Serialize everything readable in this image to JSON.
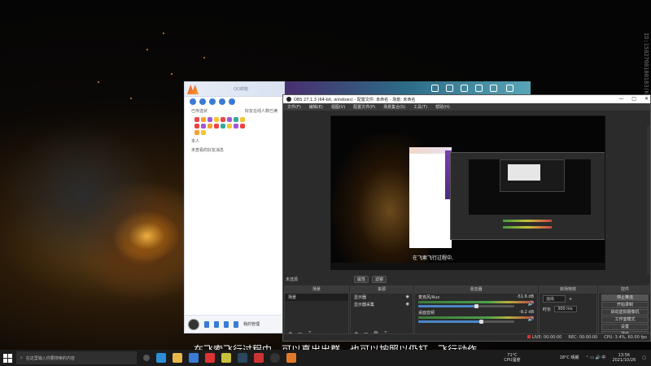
{
  "side_watermark": "ID:1582708180183(K)",
  "qq": {
    "status_hint": "QQ邮箱",
    "row1_left": "已传送状",
    "row1_right": "好友在线人数已满",
    "group_row": "在线可执行",
    "contact": "本人",
    "pending": "未查看的好友消息",
    "bottom_label": "我的管理"
  },
  "obs": {
    "title": "OBS 27.1.3 (64-bit, windows) - 配置文件: 未命名 - 场景: 未命名",
    "menu": [
      "文件(F)",
      "编辑(E)",
      "视图(V)",
      "配置文件(P)",
      "场景集合(S)",
      "工具(T)",
      "帮助(H)"
    ],
    "window_buttons": [
      "—",
      "□",
      "✕"
    ],
    "preview_subtitle": "在飞索飞行过程中,",
    "scene_bar_label": "未选源",
    "pill_properties": "属性",
    "pill_filters": "滤镜",
    "docks": {
      "scenes_title": "场景",
      "scenes": [
        "场景"
      ],
      "sources_title": "来源",
      "sources": [
        "显示器",
        "显示器采集"
      ],
      "mixer_title": "混音器",
      "mixer": [
        {
          "name": "麦克风/Aux",
          "db": "-51.6 dB",
          "level": 0.6
        },
        {
          "name": "桌面音频",
          "db": "-9.2 dB",
          "level": 0.65
        }
      ],
      "transitions_title": "转场特效",
      "transition_type": "淡出",
      "duration_label": "时长",
      "duration_value": "300 ms",
      "controls_title": "控件",
      "controls": [
        "停止推流",
        "开始录制",
        "启动虚拟摄像机",
        "工作室模式",
        "设置",
        "退出"
      ]
    },
    "status": {
      "live": "LIVE: 00:00:00",
      "rec": "REC: 00:00:00",
      "cpu": "CPU: 3.4%, 60.00 fps"
    }
  },
  "subtitle": "在飞索飞行过程中，可以真出出群，也可以按照以仍打。飞行动作。",
  "taskbar": {
    "search_placeholder": "在这里输入你要搜索的内容",
    "weather_temp": "71°C",
    "weather_label": "CPU温度",
    "temp": "18°C 晴朗",
    "time": "13:56",
    "date": "2021/10/26"
  }
}
